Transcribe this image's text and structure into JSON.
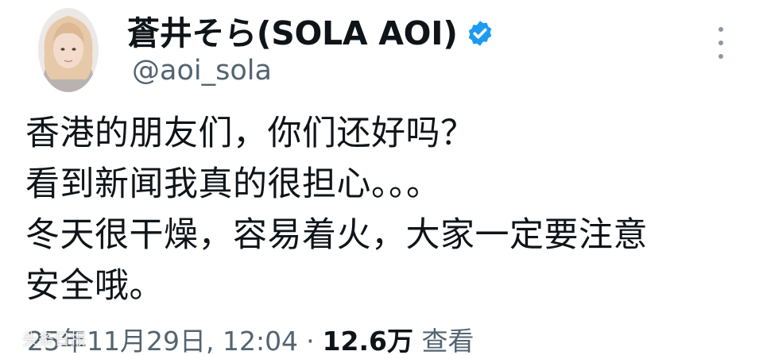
{
  "profile": {
    "display_name": "蒼井そら(SOLA AOI)",
    "handle": "@aoi_sola",
    "verified_color": "#1d9bf0"
  },
  "menu": {
    "icon": "more-vertical-icon"
  },
  "tweet": {
    "lines": [
      "香港的朋友们，你们还好吗？",
      "看到新闻我真的很担心。。。",
      "冬天很干燥，容易着火，大家一定要注意",
      "安全哦。"
    ]
  },
  "meta": {
    "datetime": "25年11月29日, 12:04",
    "separator": "·",
    "views_count": "12.6万",
    "views_label": "查看"
  },
  "watermark": {
    "text": "头条日报",
    "icon": "weibo-icon"
  }
}
